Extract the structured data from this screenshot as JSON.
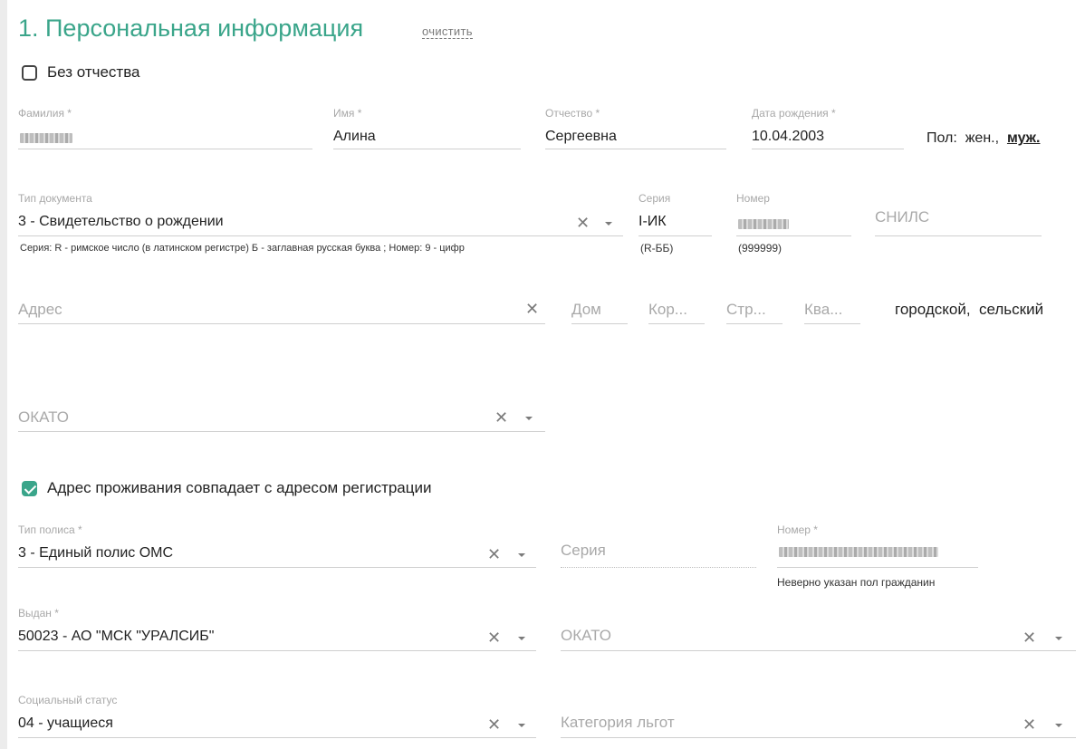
{
  "section": {
    "title": "1. Персональная информация",
    "clear_label": "очистить"
  },
  "no_patronymic": {
    "label": "Без отчества",
    "checked": false
  },
  "person": {
    "surname": {
      "label": "Фамилия *",
      "value": ""
    },
    "name": {
      "label": "Имя *",
      "value": "Алина"
    },
    "patronymic": {
      "label": "Отчество *",
      "value": "Сергеевна"
    },
    "birth_date": {
      "label": "Дата рождения *",
      "value": "10.04.2003"
    }
  },
  "gender": {
    "label": "Пол:",
    "female": "жен.",
    "separator": ",",
    "male": "муж."
  },
  "document": {
    "type": {
      "label": "Тип документа",
      "value": "3 - Свидетельство о рождении",
      "hint": "Серия: R - римское число (в латинском регистре) Б - заглавная русская буква ; Номер: 9 - цифр"
    },
    "series": {
      "label": "Серия",
      "value": "I-ИК",
      "hint": "(R-ББ)"
    },
    "number": {
      "label": "Номер",
      "value": "",
      "hint": "(999999)"
    },
    "snils": {
      "placeholder": "СНИЛС"
    }
  },
  "address": {
    "address": {
      "placeholder": "Адрес"
    },
    "house": {
      "placeholder": "Дом"
    },
    "building": {
      "placeholder": "Кор..."
    },
    "structure": {
      "placeholder": "Стр..."
    },
    "apartment": {
      "placeholder": "Ква..."
    },
    "locality": {
      "urban": "городской,",
      "rural": "сельский"
    },
    "okato": {
      "placeholder": "ОКАТО"
    }
  },
  "same_address": {
    "label": "Адрес проживания совпадает с адресом регистрации",
    "checked": true
  },
  "policy": {
    "type": {
      "label": "Тип полиса *",
      "value": "3 - Единый полис ОМС"
    },
    "series": {
      "placeholder": "Серия"
    },
    "number": {
      "label": "Номер *",
      "value": "",
      "error": "Неверно указан пол гражданин"
    },
    "issued_by": {
      "label": "Выдан *",
      "value": "50023 - АО \"МСК \"УРАЛСИБ\""
    },
    "okato": {
      "placeholder": "ОКАТО"
    }
  },
  "social": {
    "status": {
      "label": "Социальный статус",
      "value": "04 - учащиеся"
    },
    "benefits": {
      "placeholder": "Категория льгот"
    }
  },
  "colors": {
    "accent": "#3aa58a",
    "muted_label": "#a8a8a8",
    "underline": "#cfcfcf"
  },
  "icons": {
    "clear": "close-icon",
    "dropdown": "chevron-down-icon"
  }
}
